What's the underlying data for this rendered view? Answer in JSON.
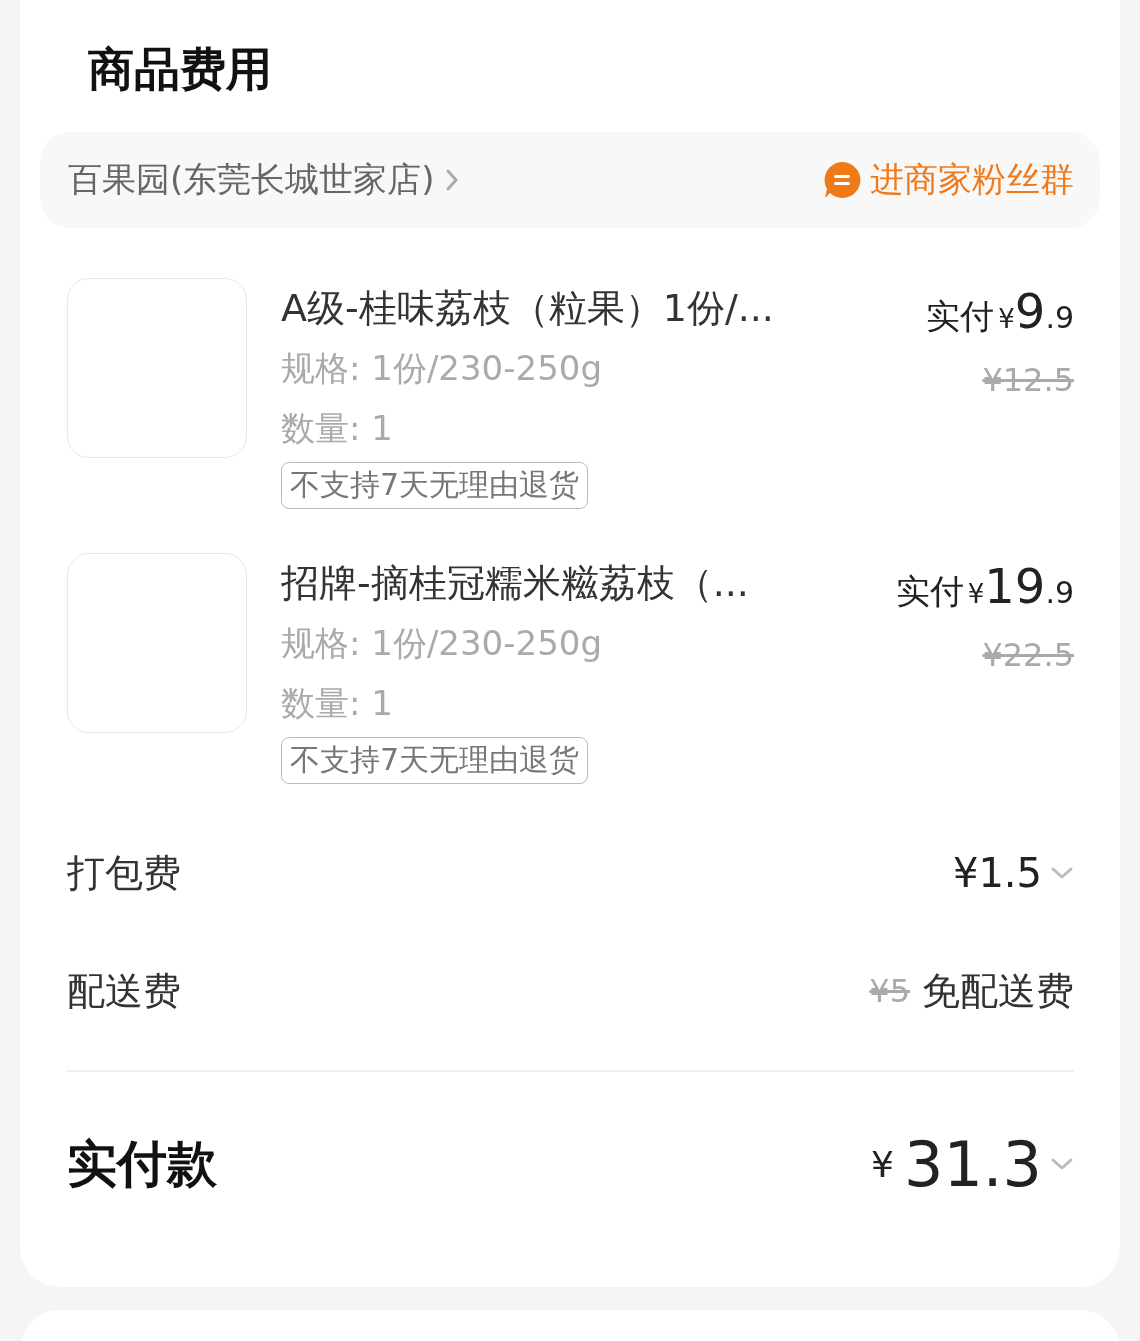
{
  "section_title": "商品费用",
  "store": {
    "name": "百果园(东莞长城世家店)",
    "fan_group": "进商家粉丝群"
  },
  "items": [
    {
      "name": "A级-桂味荔枝（粒果）1份/...",
      "spec": "规格: 1份/230-250g",
      "quantity": "数量: 1",
      "tag": "不支持7天无理由退货",
      "paid_label": "实付",
      "currency": "¥",
      "price_integer": "9",
      "price_decimal": ".9",
      "original_price": "¥12.5"
    },
    {
      "name": "招牌-摘桂冠糯米糍荔枝（...",
      "spec": "规格: 1份/230-250g",
      "quantity": "数量: 1",
      "tag": "不支持7天无理由退货",
      "paid_label": "实付",
      "currency": "¥",
      "price_integer": "19",
      "price_decimal": ".9",
      "original_price": "¥22.5"
    }
  ],
  "fees": [
    {
      "kind": "expandable",
      "label": "打包费",
      "value": "¥1.5"
    },
    {
      "kind": "waived",
      "label": "配送费",
      "original": "¥5",
      "value": "免配送费"
    }
  ],
  "total": {
    "label": "实付款",
    "currency": "¥",
    "amount": "31.3"
  }
}
